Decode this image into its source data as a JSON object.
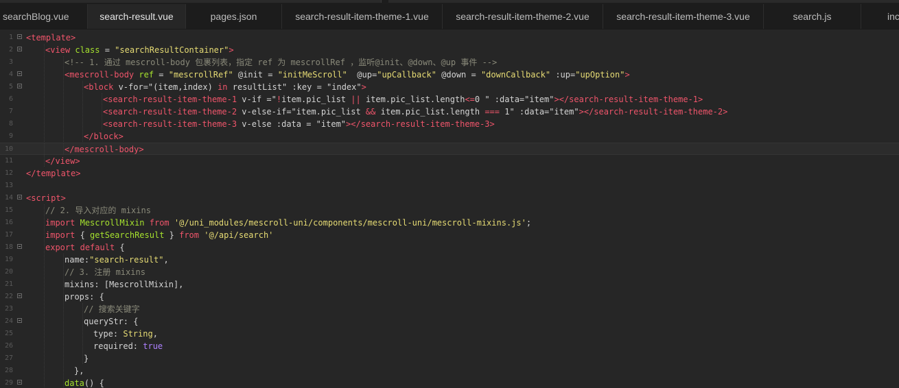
{
  "tabs": [
    {
      "label": "searchBlog.vue",
      "active": false
    },
    {
      "label": "search-result.vue",
      "active": true
    },
    {
      "label": "pages.json",
      "active": false
    },
    {
      "label": "search-result-item-theme-1.vue",
      "active": false
    },
    {
      "label": "search-result-item-theme-2.vue",
      "active": false
    },
    {
      "label": "search-result-item-theme-3.vue",
      "active": false
    },
    {
      "label": "search.js",
      "active": false
    },
    {
      "label": "inc",
      "active": false
    }
  ],
  "current_line": 10,
  "lines": [
    {
      "n": "1",
      "fold": true,
      "indent": 0,
      "tokens": [
        [
          "t-tag",
          "<template>"
        ]
      ]
    },
    {
      "n": "2",
      "fold": true,
      "indent": 1,
      "tokens": [
        [
          "t-tag",
          "<view "
        ],
        [
          "t-attr",
          "class"
        ],
        [
          "t-plain",
          " = "
        ],
        [
          "t-str",
          "\"searchResultContainer\""
        ],
        [
          "t-tag",
          ">"
        ]
      ]
    },
    {
      "n": "3",
      "fold": false,
      "indent": 2,
      "tokens": [
        [
          "t-cmt",
          "<!-- 1. 通过 mescroll-body 包裹列表，指定 ref 为 mescrollRef ，监听@init、@down、@up 事件 -->"
        ]
      ]
    },
    {
      "n": "4",
      "fold": true,
      "indent": 2,
      "tokens": [
        [
          "t-tag",
          "<mescroll-body "
        ],
        [
          "t-attr",
          "ref"
        ],
        [
          "t-plain",
          " = "
        ],
        [
          "t-str",
          "\"mescrollRef\""
        ],
        [
          "t-plain",
          " @init = "
        ],
        [
          "t-str",
          "\"initMeScroll\""
        ],
        [
          "t-plain",
          "  @up="
        ],
        [
          "t-str",
          "\"upCallback\""
        ],
        [
          "t-plain",
          " @down = "
        ],
        [
          "t-str",
          "\"downCallback\""
        ],
        [
          "t-plain",
          " :up="
        ],
        [
          "t-str",
          "\"upOption\""
        ],
        [
          "t-tag",
          ">"
        ]
      ]
    },
    {
      "n": "5",
      "fold": true,
      "indent": 3,
      "tokens": [
        [
          "t-tag",
          "<block "
        ],
        [
          "t-plain",
          "v-for=\"(item,index) "
        ],
        [
          "t-kw",
          "in"
        ],
        [
          "t-plain",
          " resultList\" :key = \"index\""
        ],
        [
          "t-tag",
          ">"
        ]
      ]
    },
    {
      "n": "6",
      "fold": false,
      "indent": 4,
      "tokens": [
        [
          "t-tag",
          "<search-result-item-theme-1 "
        ],
        [
          "t-plain",
          "v-if =\""
        ],
        [
          "t-op",
          "!"
        ],
        [
          "t-plain",
          "item.pic_list "
        ],
        [
          "t-op",
          "||"
        ],
        [
          "t-plain",
          " item.pic_list.length"
        ],
        [
          "t-op",
          "<="
        ],
        [
          "t-plain",
          "0 \" :data=\"item\""
        ],
        [
          "t-tag",
          "></search-result-item-theme-1>"
        ]
      ]
    },
    {
      "n": "7",
      "fold": false,
      "indent": 4,
      "tokens": [
        [
          "t-tag",
          "<search-result-item-theme-2 "
        ],
        [
          "t-plain",
          "v-else-if=\"item.pic_list "
        ],
        [
          "t-op",
          "&&"
        ],
        [
          "t-plain",
          " item.pic_list.length "
        ],
        [
          "t-op",
          "==="
        ],
        [
          "t-plain",
          " 1\" :data=\"item\""
        ],
        [
          "t-tag",
          "></search-result-item-theme-2>"
        ]
      ]
    },
    {
      "n": "8",
      "fold": false,
      "indent": 4,
      "tokens": [
        [
          "t-tag",
          "<search-result-item-theme-3 "
        ],
        [
          "t-plain",
          "v-else :data = \"item\""
        ],
        [
          "t-tag",
          "></search-result-item-theme-3>"
        ]
      ]
    },
    {
      "n": "9",
      "fold": false,
      "indent": 3,
      "tokens": [
        [
          "t-tag",
          "</block>"
        ]
      ]
    },
    {
      "n": "10",
      "fold": false,
      "indent": 2,
      "tokens": [
        [
          "t-tag",
          "</mescroll-body>"
        ]
      ]
    },
    {
      "n": "11",
      "fold": false,
      "indent": 1,
      "tokens": [
        [
          "t-tag",
          "</view>"
        ]
      ]
    },
    {
      "n": "12",
      "fold": false,
      "indent": 0,
      "tokens": [
        [
          "t-tag",
          "</template>"
        ]
      ]
    },
    {
      "n": "13",
      "fold": false,
      "indent": 0,
      "tokens": []
    },
    {
      "n": "14",
      "fold": true,
      "indent": 0,
      "tokens": [
        [
          "t-tag",
          "<script>"
        ]
      ]
    },
    {
      "n": "15",
      "fold": false,
      "indent": 1,
      "tokens": [
        [
          "t-cmt",
          "// 2. 导入对应的 mixins"
        ]
      ]
    },
    {
      "n": "16",
      "fold": false,
      "indent": 1,
      "tokens": [
        [
          "t-kw",
          "import"
        ],
        [
          "t-plain",
          " "
        ],
        [
          "t-fn",
          "MescrollMixin"
        ],
        [
          "t-plain",
          " "
        ],
        [
          "t-kw",
          "from"
        ],
        [
          "t-plain",
          " "
        ],
        [
          "t-str",
          "'@/uni_modules/mescroll-uni/components/mescroll-uni/mescroll-mixins.js'"
        ],
        [
          "t-plain",
          ";"
        ]
      ]
    },
    {
      "n": "17",
      "fold": false,
      "indent": 1,
      "tokens": [
        [
          "t-kw",
          "import"
        ],
        [
          "t-plain",
          " { "
        ],
        [
          "t-fn",
          "getSearchResult"
        ],
        [
          "t-plain",
          " } "
        ],
        [
          "t-kw",
          "from"
        ],
        [
          "t-plain",
          " "
        ],
        [
          "t-str",
          "'@/api/search'"
        ]
      ]
    },
    {
      "n": "18",
      "fold": true,
      "indent": 1,
      "tokens": [
        [
          "t-kw",
          "export"
        ],
        [
          "t-plain",
          " "
        ],
        [
          "t-kw",
          "default"
        ],
        [
          "t-plain",
          " {"
        ]
      ]
    },
    {
      "n": "19",
      "fold": false,
      "indent": 2,
      "tokens": [
        [
          "t-plain",
          "name:"
        ],
        [
          "t-str",
          "\"search-result\""
        ],
        [
          "t-plain",
          ","
        ]
      ]
    },
    {
      "n": "20",
      "fold": false,
      "indent": 2,
      "tokens": [
        [
          "t-cmt",
          "// 3. 注册 mixins"
        ]
      ]
    },
    {
      "n": "21",
      "fold": false,
      "indent": 2,
      "tokens": [
        [
          "t-plain",
          "mixins: [MescrollMixin],"
        ]
      ]
    },
    {
      "n": "22",
      "fold": true,
      "indent": 2,
      "tokens": [
        [
          "t-plain",
          "props: {"
        ]
      ]
    },
    {
      "n": "23",
      "fold": false,
      "indent": 3,
      "tokens": [
        [
          "t-cmt",
          "// 搜索关键字"
        ]
      ]
    },
    {
      "n": "24",
      "fold": true,
      "indent": 3,
      "tokens": [
        [
          "t-plain",
          "queryStr: {"
        ]
      ]
    },
    {
      "n": "25",
      "fold": false,
      "indent": 3.5,
      "tokens": [
        [
          "t-plain",
          "type: "
        ],
        [
          "t-type",
          "String"
        ],
        [
          "t-plain",
          ","
        ]
      ]
    },
    {
      "n": "26",
      "fold": false,
      "indent": 3.5,
      "tokens": [
        [
          "t-plain",
          "required: "
        ],
        [
          "t-bool",
          "true"
        ]
      ]
    },
    {
      "n": "27",
      "fold": false,
      "indent": 3,
      "tokens": [
        [
          "t-plain",
          "}"
        ]
      ]
    },
    {
      "n": "28",
      "fold": false,
      "indent": 2.5,
      "tokens": [
        [
          "t-plain",
          "},"
        ]
      ]
    },
    {
      "n": "29",
      "fold": true,
      "indent": 2,
      "tokens": [
        [
          "t-fn",
          "data"
        ],
        [
          "t-plain",
          "() {"
        ]
      ]
    }
  ]
}
